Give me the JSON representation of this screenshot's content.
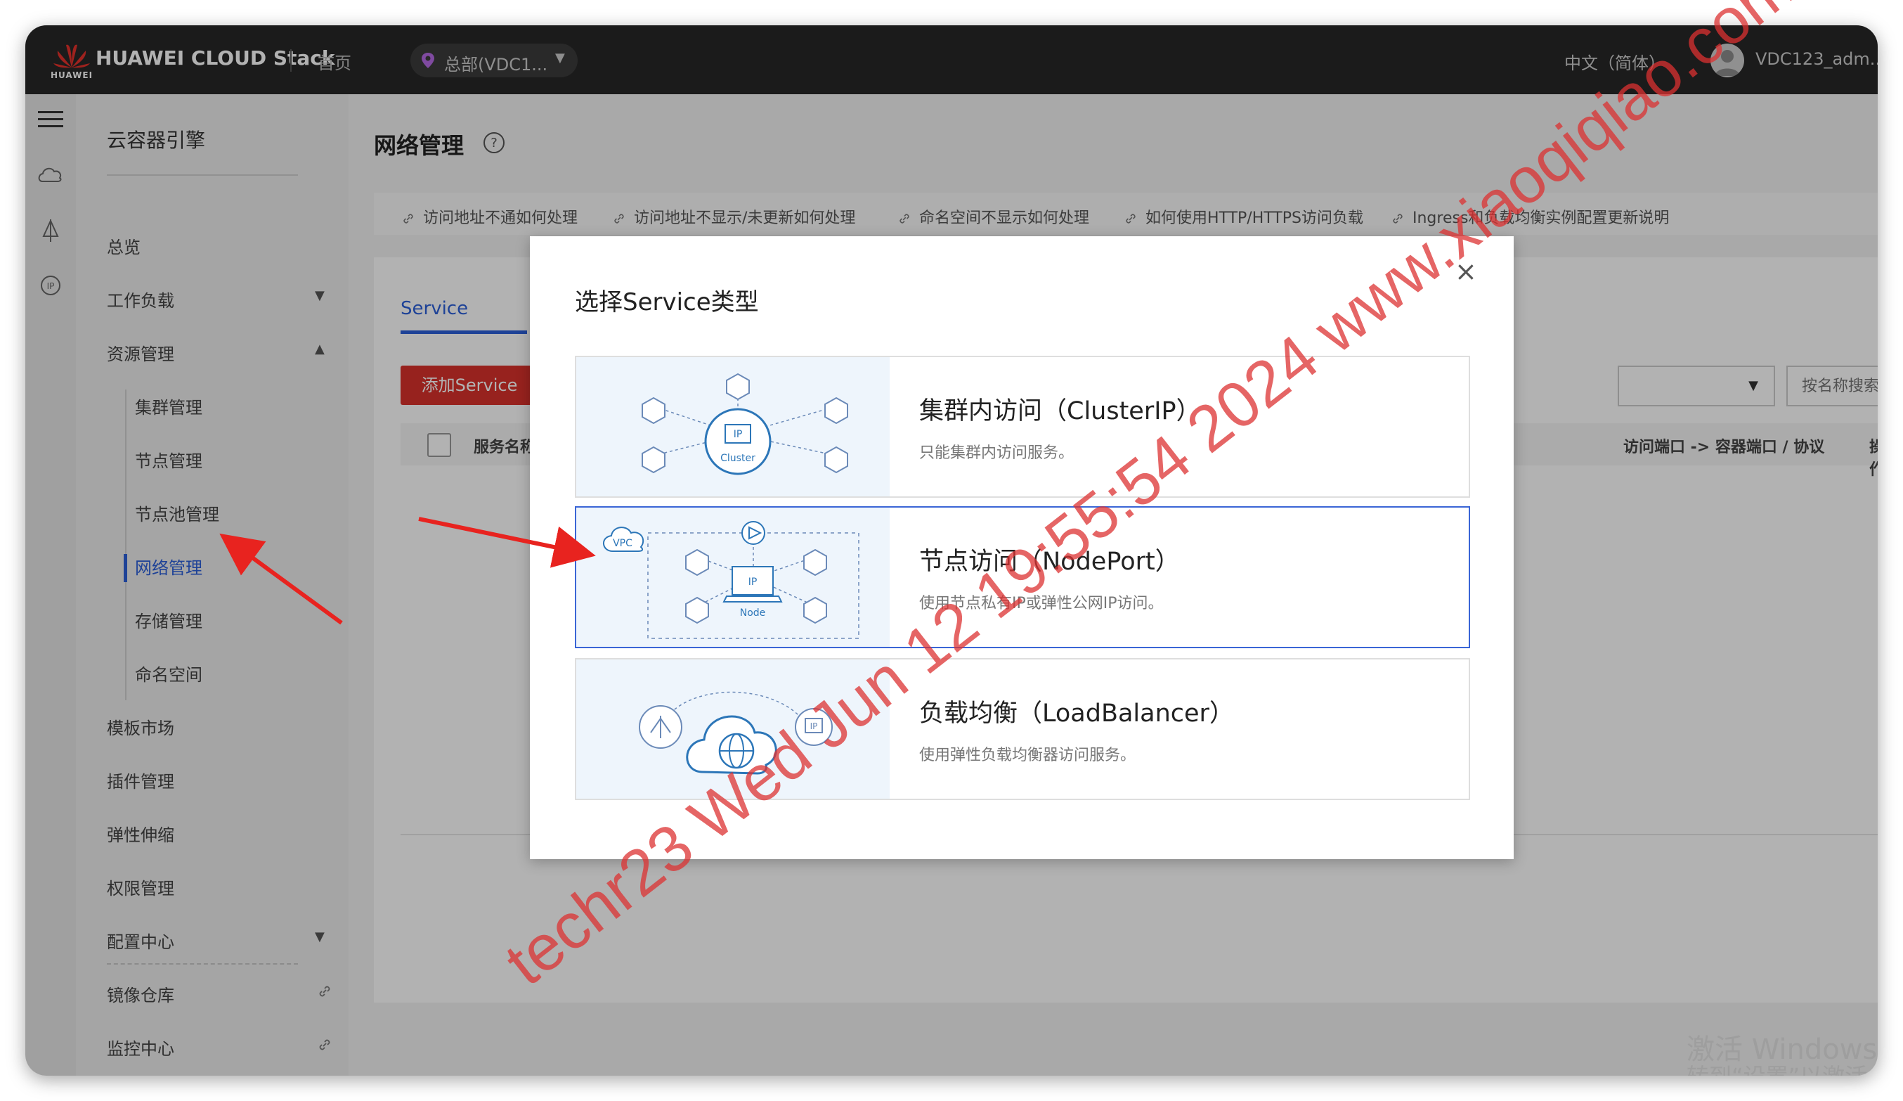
{
  "topbar": {
    "logo_text": "HUAWEI",
    "brand": "HUAWEI CLOUD Stack",
    "home": "首页",
    "region": "总部(VDC1...",
    "language": "中文（简体）",
    "user": "VDC123_adm..."
  },
  "sidebar": {
    "title": "云容器引擎",
    "items": [
      {
        "label": "总览"
      },
      {
        "label": "工作负载"
      },
      {
        "label": "资源管理"
      },
      {
        "label": "集群管理"
      },
      {
        "label": "节点管理"
      },
      {
        "label": "节点池管理"
      },
      {
        "label": "网络管理"
      },
      {
        "label": "存储管理"
      },
      {
        "label": "命名空间"
      },
      {
        "label": "模板市场"
      },
      {
        "label": "插件管理"
      },
      {
        "label": "弹性伸缩"
      },
      {
        "label": "权限管理"
      },
      {
        "label": "配置中心"
      },
      {
        "label": "镜像仓库"
      },
      {
        "label": "监控中心"
      }
    ]
  },
  "main": {
    "title": "网络管理",
    "help_links": [
      "访问地址不通如何处理",
      "访问地址不显示/未更新如何处理",
      "命名空间不显示如何处理",
      "如何使用HTTP/HTTPS访问负载",
      "Ingress和负载均衡实例配置更新说明"
    ],
    "tab": "Service",
    "add_button": "添加Service",
    "search_placeholder": "按名称搜索",
    "columns": [
      "服务名称",
      "访问端口 -> 容器端口 / 协议",
      "操作"
    ]
  },
  "modal": {
    "title": "选择Service类型",
    "close": "×",
    "options": [
      {
        "title": "集群内访问（ClusterIP）",
        "desc": "只能集群内访问服务。",
        "badge": "IP",
        "sub": "Cluster"
      },
      {
        "title": "节点访问（NodePort）",
        "desc": "使用节点私有IP或弹性公网IP访问。",
        "badge": "IP",
        "sub": "Node",
        "tag": "VPC"
      },
      {
        "title": "负载均衡（LoadBalancer）",
        "desc": "使用弹性负载均衡器访问服务。",
        "badge": "IP"
      }
    ]
  },
  "watermark": "techr23 Wed Jun 12 19:55:54 2024 www.xiaoqiqiao.com",
  "windows_watermark": {
    "line1": "激活 Windows",
    "line2": "转到“设置”以激活 Win"
  },
  "colors": {
    "accent": "#2b5fd9",
    "danger": "#d9322b",
    "topbar": "#272727",
    "watermark": "#dc3232"
  }
}
